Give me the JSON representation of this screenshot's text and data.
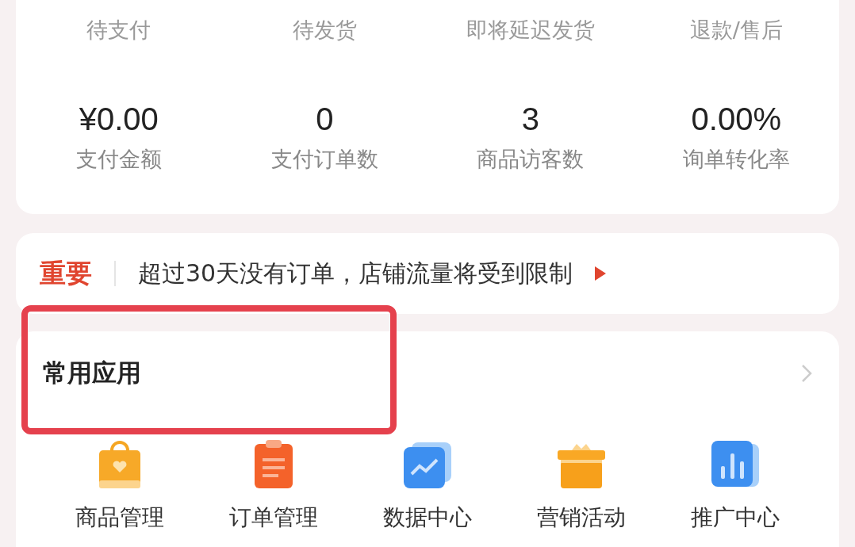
{
  "order_status": [
    {
      "label": "待支付"
    },
    {
      "label": "待发货"
    },
    {
      "label": "即将延迟发货"
    },
    {
      "label": "退款/售后"
    }
  ],
  "stats": [
    {
      "value": "¥0.00",
      "label": "支付金额"
    },
    {
      "value": "0",
      "label": "支付订单数"
    },
    {
      "value": "3",
      "label": "商品访客数"
    },
    {
      "value": "0.00%",
      "label": "询单转化率"
    }
  ],
  "notice": {
    "tag": "重要",
    "text": "超过30天没有订单，店铺流量将受到限制"
  },
  "apps": {
    "title": "常用应用",
    "items": [
      {
        "kind": "bag",
        "label": "商品管理"
      },
      {
        "kind": "clipboard",
        "label": "订单管理"
      },
      {
        "kind": "chart",
        "label": "数据中心"
      },
      {
        "kind": "gift",
        "label": "营销活动"
      },
      {
        "kind": "bars",
        "label": "推广中心"
      }
    ]
  }
}
